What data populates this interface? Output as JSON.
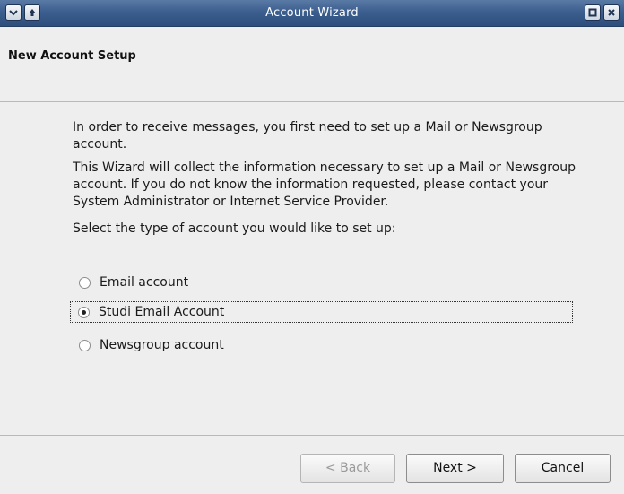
{
  "window": {
    "title": "Account Wizard",
    "buttons": {
      "menu_icon": "chevron-down-icon",
      "up_icon": "arrow-up-icon",
      "maximize_icon": "maximize-icon",
      "close_icon": "close-icon"
    }
  },
  "header": {
    "title": "New Account Setup"
  },
  "content": {
    "paragraph1": "In order to receive messages, you first need to set up a Mail or Newsgroup account.",
    "paragraph2": "This Wizard will collect the information necessary to set up a Mail or Newsgroup account. If you do not know the information requested, please contact your System Administrator or Internet Service Provider.",
    "prompt": "Select the type of account you would like to set up:",
    "options": [
      {
        "label": "Email account",
        "selected": false
      },
      {
        "label": "Studi Email Account",
        "selected": true
      },
      {
        "label": "Newsgroup account",
        "selected": false
      }
    ]
  },
  "footer": {
    "back_label": "< Back",
    "back_enabled": false,
    "next_label": "Next >",
    "cancel_label": "Cancel"
  },
  "colors": {
    "titlebar": "#3c5f8f",
    "background": "#eeeeee"
  }
}
